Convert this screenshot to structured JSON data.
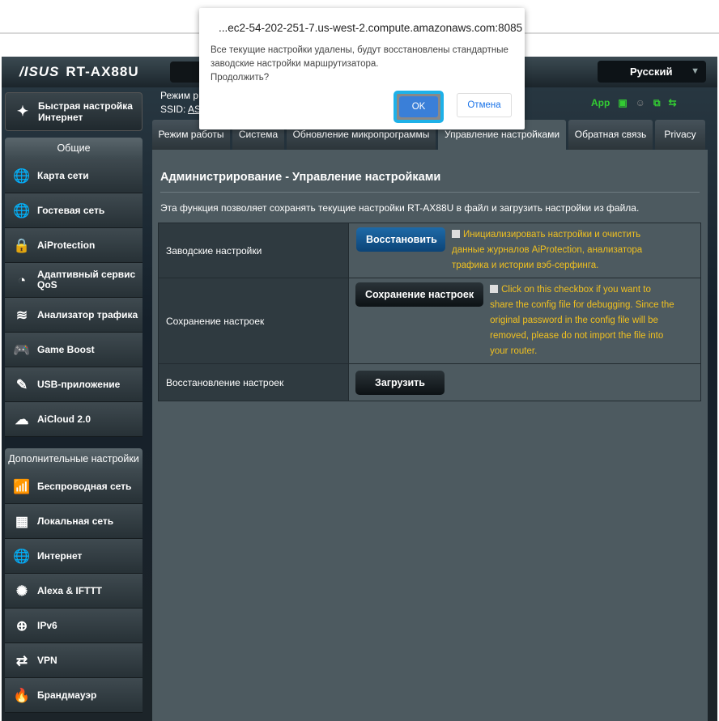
{
  "dialog": {
    "host": "...ec2-54-202-251-7.us-west-2.compute.amazonaws.com:8085",
    "message": "Все текущие настройки удалены, будут восстановлены стандартные заводские настройки маршрутизатора.",
    "question": "Продолжить?",
    "ok": "OK",
    "cancel": "Отмена"
  },
  "header": {
    "brand": "/ISUS",
    "model": "RT-AX88U",
    "language": "Русский",
    "mode_label": "Режим р",
    "ssid_label": "SSID:",
    "ssid_value": "AS",
    "app": "App"
  },
  "sidebar": {
    "quick_setup": "Быстрая настройка Интернет",
    "general_header": "Общие",
    "general": [
      {
        "label": "Карта сети",
        "icon": "globe-icon"
      },
      {
        "label": "Гостевая сеть",
        "icon": "globe-users-icon"
      },
      {
        "label": "AiProtection",
        "icon": "lock-icon"
      },
      {
        "label": "Адаптивный сервис QoS",
        "icon": "gauge-icon"
      },
      {
        "label": "Анализатор трафика",
        "icon": "traffic-icon"
      },
      {
        "label": "Game Boost",
        "icon": "gamepad-icon"
      },
      {
        "label": "USB-приложение",
        "icon": "usb-icon"
      },
      {
        "label": "AiCloud 2.0",
        "icon": "cloud-icon"
      }
    ],
    "advanced_header": "Дополнительные настройки",
    "advanced": [
      {
        "label": "Беспроводная сеть",
        "icon": "wifi-icon"
      },
      {
        "label": "Локальная сеть",
        "icon": "lan-icon"
      },
      {
        "label": "Интернет",
        "icon": "internet-icon"
      },
      {
        "label": "Alexa & IFTTT",
        "icon": "alexa-icon"
      },
      {
        "label": "IPv6",
        "icon": "ipv6-icon"
      },
      {
        "label": "VPN",
        "icon": "vpn-icon"
      },
      {
        "label": "Брандмауэр",
        "icon": "firewall-icon"
      }
    ]
  },
  "tabs": [
    {
      "label": "Режим работы"
    },
    {
      "label": "Система"
    },
    {
      "label": "Обновление микропрограммы"
    },
    {
      "label": "Управление настройками",
      "active": true
    },
    {
      "label": "Обратная связь"
    },
    {
      "label": "Privacy"
    }
  ],
  "main": {
    "title": "Администрирование - Управление настройками",
    "description": "Эта функция позволяет сохранять текущие настройки RT-AX88U в файл и загрузить настройки из файла.",
    "rows": [
      {
        "label": "Заводские настройки",
        "button": "Восстановить",
        "note": "Инициализировать настройки и очистить данные журналов AiProtection, анализатора трафика и истории вэб-серфинга."
      },
      {
        "label": "Сохранение настроек",
        "button": "Сохранение настроек",
        "note": "Click on this checkbox if you want to share the config file for debugging. Since the original password in the config file will be removed, please do not import the file into your router."
      },
      {
        "label": "Восстановление настроек",
        "button": "Загрузить"
      }
    ]
  }
}
